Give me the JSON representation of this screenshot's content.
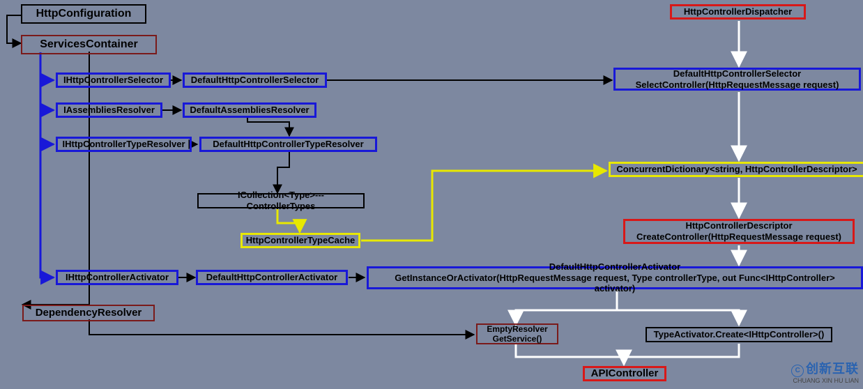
{
  "boxes": {
    "httpConfiguration": "HttpConfiguration",
    "servicesContainer": "ServicesContainer",
    "iHttpControllerSelector": "IHttpControllerSelector",
    "defaultHttpControllerSelector": "DefaultHttpControllerSelector",
    "iAssembliesResolver": "IAssembliesResolver",
    "defaultAssembliesResolver": "DefaultAssembliesResolver",
    "iHttpControllerTypeResolver": "IHttpControllerTypeResolver",
    "defaultHttpControllerTypeResolver": "DefaultHttpControllerTypeResolver",
    "iCollectionType": "ICollection<Type>---ControllerTypes",
    "httpControllerTypeCache": "HttpControllerTypeCache",
    "iHttpControllerActivator": "IHttpControllerActivator",
    "defaultHttpControllerActivator": "DefaultHttpControllerActivator",
    "dependencyResolver": "DependencyResolver",
    "httpControllerDispatcher": "HttpControllerDispatcher",
    "defaultHttpControllerSelectorCall_line1": "DefaultHttpControllerSelector",
    "defaultHttpControllerSelectorCall_line2": "SelectController(HttpRequestMessage request)",
    "concurrentDictionary": "ConcurrentDictionary<string, HttpControllerDescriptor>",
    "httpControllerDescriptor_line1": "HttpControllerDescriptor",
    "httpControllerDescriptor_line2": "CreateController(HttpRequestMessage request)",
    "defaultHttpControllerActivatorCall_line1": "DefaultHttpControllerActivator",
    "defaultHttpControllerActivatorCall_line2": "GetInstanceOrActivator(HttpRequestMessage request, Type controllerType, out Func<IHttpController> activator)",
    "emptyResolver_line1": "EmptyResolver",
    "emptyResolver_line2": "GetService()",
    "typeActivatorCreate": "TypeActivator.Create<IHttpController>()",
    "apiController": "APIController"
  },
  "watermark": {
    "brand": "创新互联",
    "sub": "CHUANG XIN HU LIAN"
  }
}
